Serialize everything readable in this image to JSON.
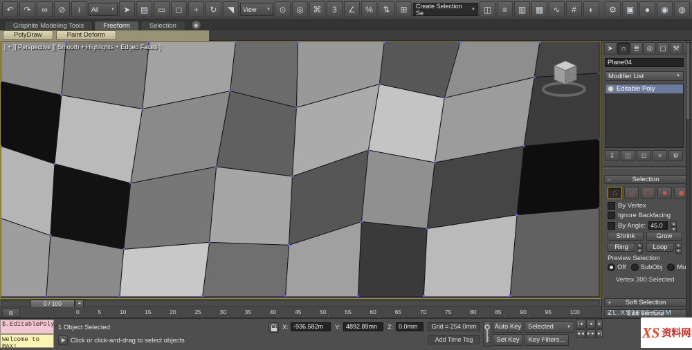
{
  "toolbar": {
    "items": [
      {
        "name": "undo-icon",
        "glyph": "↶"
      },
      {
        "name": "redo-icon",
        "glyph": "↷"
      },
      {
        "name": "select-and-link-icon",
        "glyph": "∞"
      },
      {
        "name": "unlink-selection-icon",
        "glyph": "⊘"
      },
      {
        "name": "bind-to-space-warp-icon",
        "glyph": "≀"
      },
      {
        "type": "dropdown",
        "name": "selection-filter-dropdown",
        "label": "All",
        "width": 34
      },
      {
        "name": "select-object-icon",
        "glyph": "➤"
      },
      {
        "name": "select-by-name-icon",
        "glyph": "▤"
      },
      {
        "name": "rectangular-selection-region-icon",
        "glyph": "▭"
      },
      {
        "name": "window-crossing-icon",
        "glyph": "◻"
      },
      {
        "name": "select-and-move-icon",
        "glyph": "+"
      },
      {
        "name": "select-and-rotate-icon",
        "glyph": "↻"
      },
      {
        "name": "select-and-scale-icon",
        "glyph": "◥"
      },
      {
        "type": "dropdown",
        "name": "reference-coordinate-dropdown",
        "label": "View",
        "width": 40
      },
      {
        "name": "use-pivot-center-icon",
        "glyph": "⊙"
      },
      {
        "name": "select-and-manipulate-icon",
        "glyph": "◎"
      },
      {
        "name": "keyboard-override-icon",
        "glyph": "⌘"
      },
      {
        "name": "snaps-toggle-icon",
        "glyph": "3"
      },
      {
        "name": "angle-snap-icon",
        "glyph": "∠"
      },
      {
        "name": "percent-snap-icon",
        "glyph": "%"
      },
      {
        "name": "spinner-snap-icon",
        "glyph": "⇅"
      },
      {
        "name": "edit-named-selection-sets-icon",
        "glyph": "⊞"
      },
      {
        "type": "combo",
        "name": "named-selection-set-combo",
        "label": "Create Selection Se",
        "width": 86
      },
      {
        "name": "mirror-icon",
        "glyph": "◫"
      },
      {
        "name": "align-icon",
        "glyph": "≡"
      },
      {
        "name": "layer-manager-icon",
        "glyph": "▥"
      },
      {
        "name": "graphite-ribbon-toggle-icon",
        "glyph": "▦"
      },
      {
        "name": "curve-editor-icon",
        "glyph": "∿"
      },
      {
        "name": "schematic-view-icon",
        "glyph": "#"
      },
      {
        "name": "material-editor-icon",
        "glyph": "◐"
      },
      {
        "type": "spacer"
      },
      {
        "name": "render-setup-icon",
        "glyph": "⚙"
      },
      {
        "name": "rendered-frame-window-icon",
        "glyph": "▣"
      },
      {
        "name": "render-production-icon",
        "glyph": "●"
      },
      {
        "name": "render-iterative-icon",
        "glyph": "◉"
      },
      {
        "name": "quick-render-icon",
        "glyph": "◍"
      }
    ]
  },
  "ribbon": {
    "tabs": [
      {
        "label": "Graphite Modeling Tools",
        "active": false
      },
      {
        "label": "Freeform",
        "active": true
      },
      {
        "label": "Selection",
        "active": false
      }
    ],
    "minimize_glyph": "◉",
    "subtabs": [
      {
        "label": "PolyDraw"
      },
      {
        "label": "Paint Deform"
      }
    ]
  },
  "viewport": {
    "label": "[ + ][ Perspective ][ Smooth + Highlights + Edged Faces ]",
    "mesh": {
      "edge_color": "#161616",
      "vertex_color": "#5668e8",
      "points": [
        [
          [
            0,
            0
          ],
          [
            95,
            0
          ],
          [
            215,
            0
          ],
          [
            340,
            0
          ],
          [
            430,
            0
          ],
          [
            555,
            0
          ],
          [
            665,
            0
          ],
          [
            780,
            0
          ],
          [
            866,
            0
          ]
        ],
        [
          [
            0,
            58
          ],
          [
            88,
            78
          ],
          [
            205,
            98
          ],
          [
            332,
            72
          ],
          [
            428,
            96
          ],
          [
            548,
            62
          ],
          [
            642,
            82
          ],
          [
            772,
            52
          ],
          [
            866,
            46
          ]
        ],
        [
          [
            0,
            152
          ],
          [
            78,
            178
          ],
          [
            188,
            206
          ],
          [
            312,
            182
          ],
          [
            422,
            196
          ],
          [
            532,
            158
          ],
          [
            628,
            176
          ],
          [
            757,
            152
          ],
          [
            866,
            142
          ]
        ],
        [
          [
            0,
            257
          ],
          [
            72,
            282
          ],
          [
            178,
            302
          ],
          [
            302,
            292
          ],
          [
            417,
            296
          ],
          [
            522,
            262
          ],
          [
            617,
            272
          ],
          [
            747,
            252
          ],
          [
            866,
            242
          ]
        ],
        [
          [
            0,
            371
          ],
          [
            66,
            371
          ],
          [
            172,
            371
          ],
          [
            292,
            371
          ],
          [
            412,
            371
          ],
          [
            517,
            371
          ],
          [
            612,
            371
          ],
          [
            737,
            371
          ],
          [
            866,
            371
          ]
        ]
      ],
      "fills": [
        [
          "#8f8f8f",
          "#7a7a7a",
          "#a2a2a2",
          "#6b6b6b",
          "#999999",
          "#585858",
          "#8e8e8e",
          "#454545"
        ],
        [
          "#101010",
          "#bababa",
          "#8a8a8a",
          "#606060",
          "#ababab",
          "#c4c4c4",
          "#9c9c9c",
          "#3c3c3c"
        ],
        [
          "#b5b5b5",
          "#121212",
          "#777777",
          "#a6a6a6",
          "#565656",
          "#909090",
          "#454545",
          "#0e0e0e"
        ],
        [
          "#9e9e9e",
          "#8a8a8a",
          "#c8c8c8",
          "#6f6f6f",
          "#a0a0a0",
          "#3a3a3a",
          "#bababa",
          "#616161"
        ]
      ]
    }
  },
  "right_panel": {
    "tabs": [
      {
        "name": "create-tab-icon",
        "glyph": "➤",
        "active": false
      },
      {
        "name": "modify-tab-icon",
        "glyph": "∩",
        "active": true
      },
      {
        "name": "hierarchy-tab-icon",
        "glyph": "≣",
        "active": false
      },
      {
        "name": "motion-tab-icon",
        "glyph": "◎",
        "active": false
      },
      {
        "name": "display-tab-icon",
        "glyph": "▢",
        "active": false
      },
      {
        "name": "utilities-tab-icon",
        "glyph": "⚒",
        "active": false
      },
      {
        "name": "panel-arrow-icon",
        "glyph": "▸",
        "active": false
      }
    ],
    "object_name": "Plane04",
    "modifier_list_label": "Modifier List",
    "stack_item": "Editable Poly",
    "stack_buttons": [
      {
        "name": "pin-stack-icon",
        "glyph": "↧"
      },
      {
        "name": "show-end-result-icon",
        "glyph": "◫"
      },
      {
        "name": "make-unique-icon",
        "glyph": "⊡"
      },
      {
        "name": "remove-modifier-icon",
        "glyph": "×"
      },
      {
        "name": "configure-modifier-sets-icon",
        "glyph": "⚙"
      }
    ],
    "selection": {
      "title": "Selection",
      "subobject_buttons": [
        {
          "name": "vertex-mode-button",
          "glyph": "∴",
          "active": true
        },
        {
          "name": "edge-mode-button",
          "glyph": "◿",
          "active": false
        },
        {
          "name": "border-mode-button",
          "glyph": "◯",
          "active": false
        },
        {
          "name": "polygon-mode-button",
          "glyph": "■",
          "active": false
        },
        {
          "name": "element-mode-button",
          "glyph": "◼",
          "active": false
        }
      ],
      "by_vertex": "By Vertex",
      "ignore_backfacing": "Ignore Backfacing",
      "by_angle_label": "By Angle:",
      "by_angle_value": "45.0",
      "shrink": "Shrink",
      "grow": "Grow",
      "ring": "Ring",
      "loop": "Loop",
      "preview_label": "Preview Selection",
      "preview_off": "Off",
      "preview_subobj": "SubObj",
      "preview_multi": "Multi",
      "status": "Vertex 300 Selected"
    },
    "soft_selection": "Soft Selection",
    "edit_vertices": "Edit Vertices"
  },
  "timeline": {
    "slider_label": "0 / 100",
    "ticks": [
      "0",
      "5",
      "10",
      "15",
      "20",
      "25",
      "30",
      "35",
      "40",
      "45",
      "50",
      "55",
      "60",
      "65",
      "70",
      "75",
      "80",
      "85",
      "90",
      "95",
      "100"
    ]
  },
  "status_bar": {
    "listener_line1": "$.EditablePoly.",
    "listener_line2": "Welcome to MAX!",
    "selection_status": "1 Object Selected",
    "prompt": "Click or click-and-drag to select objects",
    "x_label": "X:",
    "x_value": "-936.582m",
    "y_label": "Y:",
    "y_value": "4892.89mn",
    "z_label": "Z:",
    "z_value": "0.0mm",
    "grid_label": "Grid = 254.0mm",
    "add_time_tag": "Add Time Tag",
    "auto_key": "Auto Key",
    "set_key": "Set Key",
    "selected_dropdown": "Selected",
    "key_filters": "Key Filters...",
    "playback": [
      {
        "name": "go-to-start-button",
        "glyph": "|◄"
      },
      {
        "name": "previous-frame-button",
        "glyph": "◄"
      },
      {
        "name": "play-button",
        "glyph": "►"
      },
      {
        "name": "previous-key-button",
        "glyph": "◄◄"
      },
      {
        "name": "next-key-button",
        "glyph": "►►"
      },
      {
        "name": "go-to-end-button",
        "glyph": "►|"
      }
    ]
  },
  "watermark": {
    "site": "ZL.XS1616.COM",
    "logo_mark": "XS",
    "logo_text": "资料网"
  }
}
